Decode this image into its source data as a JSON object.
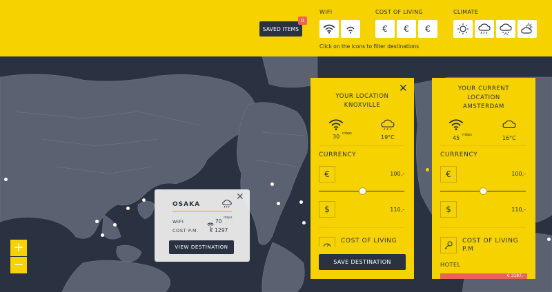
{
  "toolbar": {
    "saved_label": "SAVED ITEMS",
    "saved_count": "0",
    "filter_groups": [
      {
        "title": "WIFI",
        "icons": [
          "wifi-strong-icon",
          "wifi-weak-icon"
        ]
      },
      {
        "title": "COST OF LIVING",
        "icons": [
          "euro-icon",
          "euro-icon",
          "euro-icon"
        ]
      },
      {
        "title": "CLIMATE",
        "icons": [
          "sun-icon",
          "rain-cloud-icon",
          "snow-cloud-icon",
          "partly-cloudy-icon"
        ]
      }
    ],
    "filter_hint": "Click on the icons to filter destinations",
    "euro_symbol": "€"
  },
  "map": {
    "zoom_in": "+",
    "zoom_out": "−"
  },
  "popup": {
    "title": "OSAKA",
    "close": "✕",
    "wifi_label": "WIFI",
    "wifi_value": "70",
    "wifi_unit": "mbps",
    "cost_label": "COST P.M.",
    "cost_value": "€ 1297",
    "button": "VIEW DESTINATION"
  },
  "cards": [
    {
      "heading_line1": "YOUR LOCATION",
      "heading_line2": "KNOXVILLE",
      "close": "✕",
      "wifi_value": "30",
      "wifi_unit": "mbps",
      "temp": "19°C",
      "currency_label": "CURRENCY",
      "euro_symbol": "€",
      "euro_amount": "100,-",
      "dollar_symbol": "$",
      "dollar_amount": "110,-",
      "cost_label": "COST OF LIVING",
      "save_label": "SAVE DESTINATION"
    },
    {
      "heading_line1": "YOUR CURRENT",
      "heading_line2": "LOCATION",
      "heading_line3": "AMSTERDAM",
      "wifi_value": "45",
      "wifi_unit": "mbps",
      "temp": "16°C",
      "currency_label": "CURRENCY",
      "euro_symbol": "€",
      "euro_amount": "100,-",
      "dollar_symbol": "$",
      "dollar_amount": "110,-",
      "cost_label_line1": "COST OF LIVING",
      "cost_label_line2": "P.M",
      "hotel_label": "HOTEL",
      "hotel_value": "€ 3187,-"
    }
  ],
  "colors": {
    "accent": "#f5d200",
    "dark": "#2a3242",
    "badge": "#e8645a"
  }
}
